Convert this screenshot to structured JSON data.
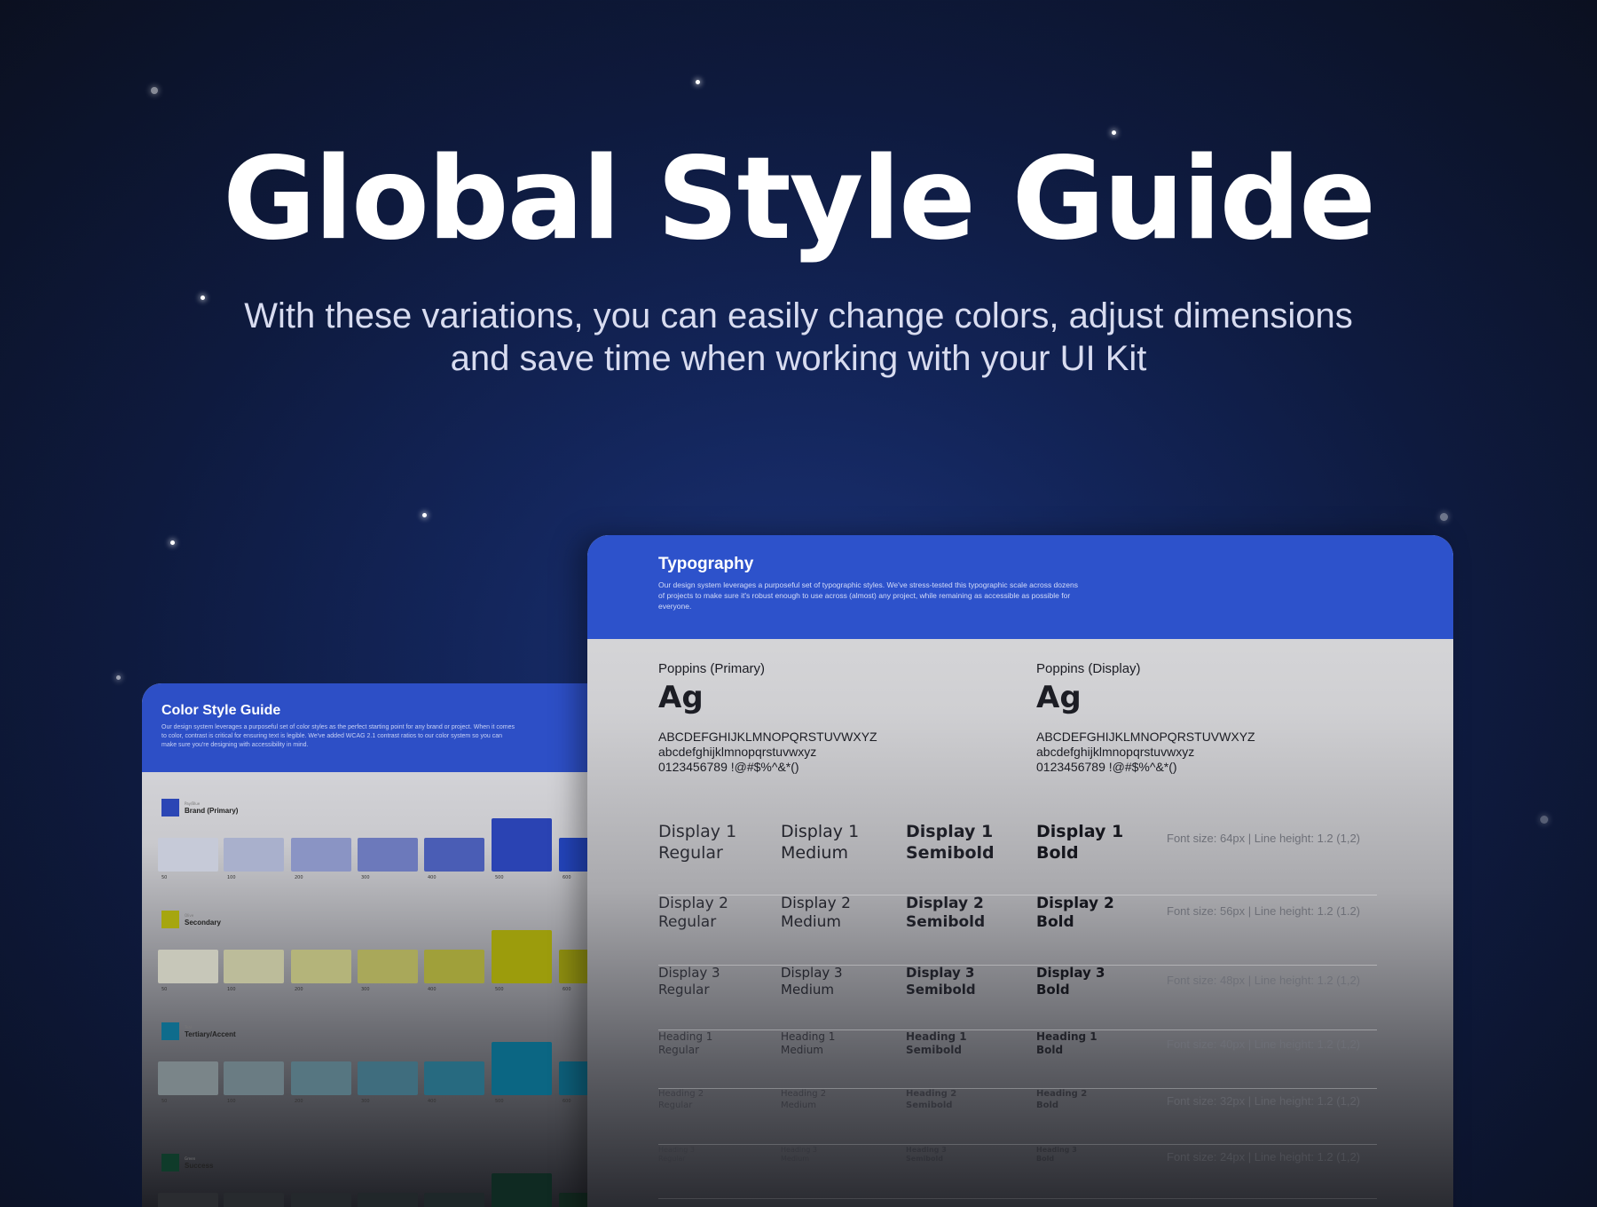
{
  "hero": {
    "title": "Global Style Guide",
    "subtitle_line1": "With these variations, you can easily change colors, adjust dimensions",
    "subtitle_line2": "and save time when working with your UI Kit"
  },
  "color_card": {
    "title": "Color Style Guide",
    "description": "Our design system leverages a purposeful set of color styles as the perfect starting point for any brand or project. When it comes to color, contrast is critical for ensuring text is legible. We've added WCAG 2.1 contrast ratios to our color system so you can make sure you're designing with accessibility in mind.",
    "palettes": [
      {
        "caption": "Pay/Blue",
        "name": "Brand (Primary)",
        "color": "#2b46b5",
        "swatches": [
          "#c6cad8",
          "#a9b0cc",
          "#8a94c4",
          "#6c79bb",
          "#4a5db5",
          "#2a43b3",
          "#2344bb"
        ],
        "labels": [
          "50",
          "100",
          "200",
          "300",
          "400",
          "500",
          "600"
        ]
      },
      {
        "caption": "Olive",
        "name": "Secondary",
        "color": "#a6a60f",
        "swatches": [
          "#c7c7b9",
          "#bcbc9a",
          "#b4b47a",
          "#a9a85a",
          "#a0a03a",
          "#9c9c0c",
          "#8d8d10"
        ],
        "labels": [
          "50",
          "100",
          "200",
          "300",
          "400",
          "500",
          "600"
        ]
      },
      {
        "caption": "Teal",
        "name": "Tertiary/Accent",
        "color": "#0f6c8c",
        "swatches": [
          "#7a8589",
          "#6a7c83",
          "#567681",
          "#3f6d7e",
          "#276a80",
          "#0b6683",
          "#0d5f7a"
        ],
        "labels": [
          "50",
          "100",
          "200",
          "300",
          "400",
          "500",
          "600"
        ]
      },
      {
        "caption": "Green",
        "name": "Success",
        "color": "#0f3b2a",
        "swatches": [
          "#2a2c30",
          "#272a2e",
          "#24282c",
          "#21272a",
          "#1e2729",
          "#0f2a22",
          "#12281f"
        ],
        "labels": [
          "",
          "",
          "",
          "",
          "",
          "",
          ""
        ]
      }
    ]
  },
  "type_card": {
    "title": "Typography",
    "description": "Our design system leverages a purposeful set of typographic styles. We've stress-tested this typographic scale across dozens of projects to make sure it's robust enough to use across (almost) any project, while remaining as accessible as possible for everyone.",
    "fonts": [
      {
        "name": "Poppins (Primary)",
        "sample": "Ag",
        "upper": "ABCDEFGHIJKLMNOPQRSTUVWXYZ",
        "lower": "abcdefghijklmnopqrstuvwxyz",
        "digits": "0123456789 !@#$%^&*()"
      },
      {
        "name": "Poppins (Display)",
        "sample": "Ag",
        "upper": "ABCDEFGHIJKLMNOPQRSTUVWXYZ",
        "lower": "abcdefghijklmnopqrstuvwxyz",
        "digits": "0123456789 !@#$%^&*()"
      }
    ],
    "rows": [
      {
        "name": "Display 1",
        "weights": [
          "Regular",
          "Medium",
          "Semibold",
          "Bold"
        ],
        "spec": "Font size: 64px | Line height: 1.2 (1,2)"
      },
      {
        "name": "Display 2",
        "weights": [
          "Regular",
          "Medium",
          "Semibold",
          "Bold"
        ],
        "spec": "Font size: 56px | Line height: 1.2 (1.2)"
      },
      {
        "name": "Display 3",
        "weights": [
          "Regular",
          "Medium",
          "Semibold",
          "Bold"
        ],
        "spec": "Font size: 48px | Line height: 1.2 (1,2)"
      },
      {
        "name": "Heading 1",
        "weights": [
          "Regular",
          "Medium",
          "Semibold",
          "Bold"
        ],
        "spec": "Font size: 40px | Line height: 1.2 (1,2)"
      },
      {
        "name": "Heading 2",
        "weights": [
          "Regular",
          "Medium",
          "Semibold",
          "Bold"
        ],
        "spec": "Font size: 32px | Line height: 1.2 (1,2)"
      },
      {
        "name": "Heading 3",
        "weights": [
          "Regular",
          "Medium",
          "Semibold",
          "Bold"
        ],
        "spec": "Font size: 24px | Line height: 1.2 (1,2)"
      }
    ]
  }
}
